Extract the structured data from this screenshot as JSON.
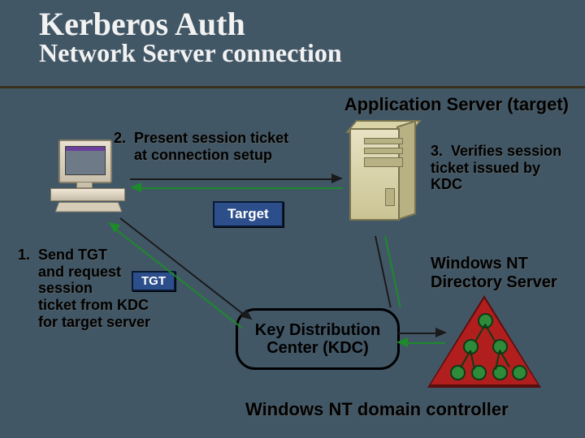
{
  "title": "Kerberos Auth",
  "subtitle": "Network Server connection",
  "labels": {
    "app_server": "Application Server (target)",
    "domain_controller": "Windows NT domain controller",
    "nt_dir": "Windows NT Directory Server",
    "kdc": "Key Distribution Center (KDC)"
  },
  "badges": {
    "target": "Target",
    "tgt": "TGT"
  },
  "steps": {
    "s1": "1.  Send TGT and request session ticket from KDC for target server",
    "s2": "2.  Present session ticket at connection setup",
    "s3": "3.  Verifies session ticket issued by KDC"
  }
}
